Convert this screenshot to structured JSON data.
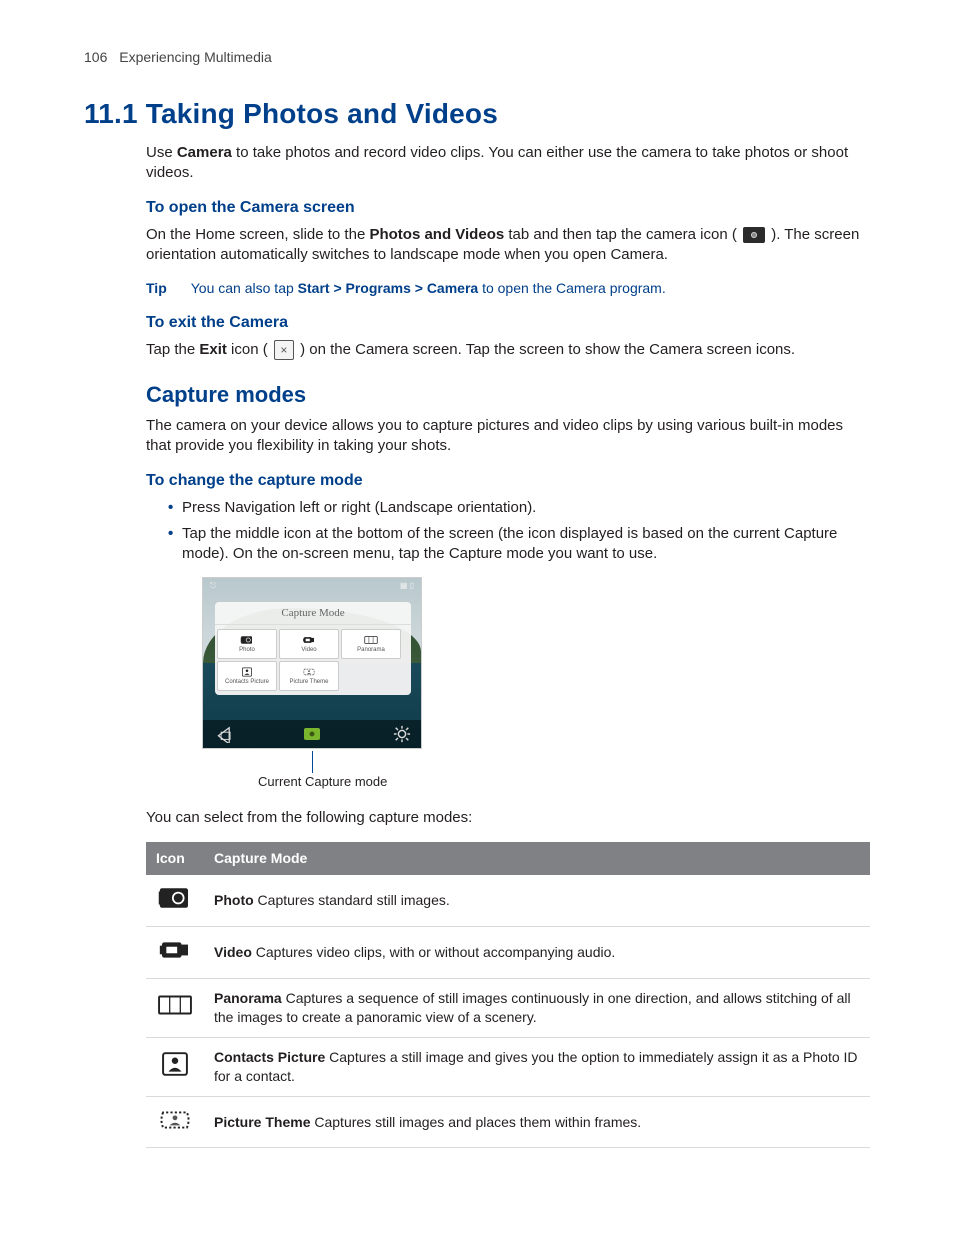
{
  "header": {
    "page_number": "106",
    "section_title": "Experiencing Multimedia"
  },
  "h1": "11.1  Taking Photos and Videos",
  "intro_a": "Use ",
  "intro_b": "Camera",
  "intro_c": " to take photos and record video clips. You can either use the camera to take photos or shoot videos.",
  "open": {
    "heading": "To open the Camera screen",
    "p1a": "On the Home screen, slide to the ",
    "p1b": "Photos and Videos",
    "p1c": " tab and then tap the camera icon ( ",
    "p1d": " ). The screen orientation automatically switches to landscape mode when you open Camera."
  },
  "tip": {
    "label": "Tip",
    "a": "You can also tap ",
    "b": "Start > Programs > Camera",
    "c": " to open the Camera program."
  },
  "exit": {
    "heading": "To exit the Camera",
    "a": "Tap the ",
    "b": "Exit",
    "c": " icon ( ",
    "d": " ) on the Camera screen. Tap the screen to show the Camera screen icons."
  },
  "capture": {
    "heading": "Capture modes",
    "intro": "The camera on your device allows you to capture pictures and video clips by using various built-in modes that provide you flexibility in taking your shots.",
    "change_heading": "To change the capture mode",
    "bullets": [
      "Press Navigation left or right (Landscape orientation).",
      "Tap the middle icon at the bottom of the screen (the icon displayed is based on the current Capture mode). On the on-screen menu, tap the Capture mode you want to use."
    ],
    "panel_title": "Capture Mode",
    "panel_items": [
      "Photo",
      "Video",
      "Panorama",
      "Contacts Picture",
      "Picture Theme"
    ],
    "caption": "Current Capture mode",
    "table_intro": "You can select from the following capture modes:",
    "table_headers": {
      "icon": "Icon",
      "mode": "Capture Mode"
    },
    "modes": [
      {
        "name": "Photo",
        "desc": "  Captures standard still images."
      },
      {
        "name": "Video",
        "desc": "  Captures video clips, with or without accompanying audio."
      },
      {
        "name": "Panorama",
        "desc": "  Captures a sequence of still images continuously in one direction, and allows stitching of all the images to create a panoramic view of a scenery."
      },
      {
        "name": "Contacts Picture",
        "desc": "  Captures a still image and gives you the option to immediately assign it as a Photo ID for a contact."
      },
      {
        "name": "Picture Theme",
        "desc": "  Captures still images and places them within frames."
      }
    ]
  }
}
